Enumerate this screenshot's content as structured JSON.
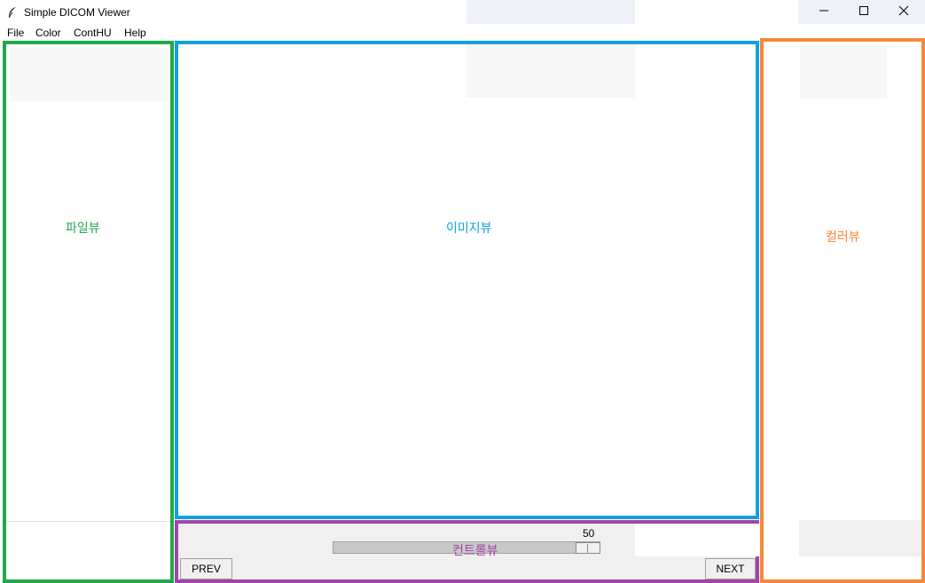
{
  "window": {
    "title": "Simple DICOM Viewer",
    "icon": "feather-icon",
    "controls": [
      "minimize-icon",
      "maximize-icon",
      "close-icon"
    ]
  },
  "menu": {
    "items": [
      "File",
      "Color",
      "ContHU",
      "Help"
    ]
  },
  "panels": {
    "file_view": {
      "label": "파일뷰",
      "border_color": "#22a84a"
    },
    "image_view": {
      "label": "이미지뷰",
      "border_color": "#12a0e0"
    },
    "color_view": {
      "label": "컬러뷰",
      "border_color": "#f5883a"
    },
    "control_view": {
      "label": "컨트롤뷰",
      "border_color": "#a146a8"
    }
  },
  "controls": {
    "slider_value": "50",
    "slider_level": 1.0,
    "prev_label": "PREV",
    "next_label": "NEXT"
  }
}
